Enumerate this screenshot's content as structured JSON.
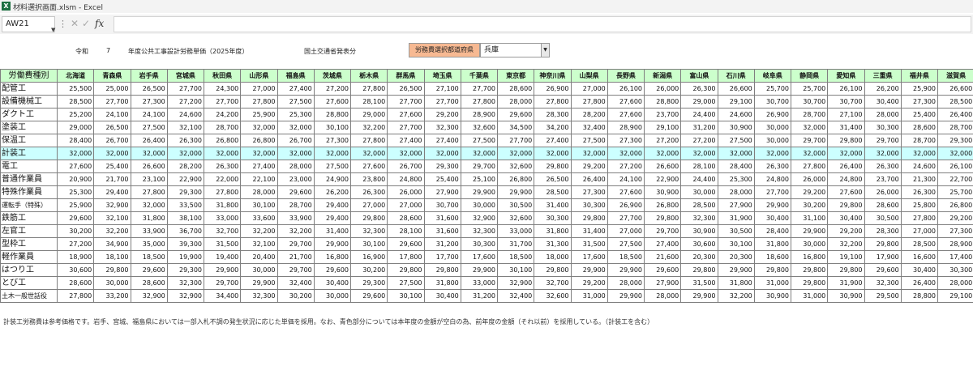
{
  "window": {
    "app_icon": "X",
    "title": "材料選択画面.xlsm - Excel"
  },
  "formula_bar": {
    "name_box": "AW21",
    "cancel_glyph": "✕",
    "enter_glyph": "✓",
    "fx_label": "fx",
    "formula": ""
  },
  "sheet_header": {
    "era": "令和",
    "era_year": "7",
    "title": "年度公共工事設計労務単価（2025年度）",
    "publisher": "国土交通省発表分",
    "pref_select_label": "労務費選択都道府県",
    "pref_select_value": "兵庫"
  },
  "table": {
    "corner": "労働費種別",
    "prefectures": [
      "北海道",
      "青森県",
      "岩手県",
      "宮城県",
      "秋田県",
      "山形県",
      "福島県",
      "茨城県",
      "栃木県",
      "群馬県",
      "埼玉県",
      "千葉県",
      "東京都",
      "神奈川県",
      "山梨県",
      "長野県",
      "新潟県",
      "富山県",
      "石川県",
      "岐阜県",
      "静岡県",
      "愛知県",
      "三重県",
      "福井県",
      "滋賀県",
      "京都府"
    ],
    "rows": [
      {
        "label": "配管工",
        "values": [
          "25,500",
          "25,000",
          "26,500",
          "27,700",
          "24,300",
          "27,000",
          "27,400",
          "27,200",
          "27,800",
          "26,500",
          "27,100",
          "27,700",
          "28,600",
          "26,900",
          "27,000",
          "26,100",
          "26,000",
          "26,300",
          "26,600",
          "25,700",
          "25,700",
          "26,100",
          "26,200",
          "25,900",
          "26,600",
          "26,500"
        ]
      },
      {
        "label": "設備機械工",
        "values": [
          "28,500",
          "27,700",
          "27,300",
          "27,200",
          "27,700",
          "27,800",
          "27,500",
          "27,600",
          "28,100",
          "27,700",
          "27,700",
          "27,800",
          "28,000",
          "27,800",
          "27,800",
          "27,600",
          "28,800",
          "29,000",
          "29,100",
          "30,700",
          "30,700",
          "30,700",
          "30,400",
          "27,300",
          "28,500",
          "28,200"
        ]
      },
      {
        "label": "ダクト工",
        "values": [
          "25,200",
          "24,100",
          "24,100",
          "24,600",
          "24,200",
          "25,900",
          "25,300",
          "28,800",
          "29,000",
          "27,600",
          "29,200",
          "28,900",
          "29,600",
          "28,300",
          "28,200",
          "27,600",
          "23,700",
          "24,400",
          "24,600",
          "26,900",
          "28,700",
          "27,100",
          "28,000",
          "25,400",
          "26,400",
          "26,800"
        ]
      },
      {
        "label": "塗装工",
        "values": [
          "29,000",
          "26,500",
          "27,500",
          "32,100",
          "28,700",
          "32,000",
          "32,000",
          "30,100",
          "32,200",
          "27,700",
          "32,300",
          "32,600",
          "34,500",
          "34,200",
          "32,400",
          "28,900",
          "29,100",
          "31,200",
          "30,900",
          "30,000",
          "32,000",
          "31,400",
          "30,300",
          "28,600",
          "28,700",
          "29,600"
        ]
      },
      {
        "label": "保温工",
        "values": [
          "28,400",
          "26,700",
          "26,400",
          "26,300",
          "26,800",
          "26,800",
          "26,700",
          "27,300",
          "27,800",
          "27,400",
          "27,400",
          "27,500",
          "27,700",
          "27,400",
          "27,500",
          "27,300",
          "27,200",
          "27,200",
          "27,500",
          "30,000",
          "29,700",
          "29,800",
          "29,700",
          "28,700",
          "29,300",
          "29,900"
        ]
      },
      {
        "label": "計装工",
        "highlight": true,
        "values": [
          "32,000",
          "32,000",
          "32,000",
          "32,000",
          "32,000",
          "32,000",
          "32,000",
          "32,000",
          "32,000",
          "32,000",
          "32,000",
          "32,000",
          "32,000",
          "32,000",
          "32,000",
          "32,000",
          "32,000",
          "32,000",
          "32,000",
          "32,000",
          "32,000",
          "32,000",
          "32,000",
          "32,000",
          "32,000",
          "32,000"
        ]
      },
      {
        "label": "電工",
        "values": [
          "27,600",
          "25,400",
          "26,600",
          "28,200",
          "26,300",
          "27,400",
          "28,000",
          "27,500",
          "27,600",
          "26,700",
          "29,300",
          "29,700",
          "32,600",
          "29,800",
          "29,200",
          "27,200",
          "26,600",
          "28,100",
          "28,400",
          "26,300",
          "27,800",
          "26,400",
          "26,300",
          "24,600",
          "26,100",
          "25,500"
        ]
      },
      {
        "label": "普通作業員",
        "values": [
          "20,900",
          "21,700",
          "23,100",
          "22,900",
          "22,000",
          "22,100",
          "23,000",
          "24,900",
          "23,800",
          "24,800",
          "25,400",
          "25,100",
          "26,800",
          "26,500",
          "26,400",
          "24,100",
          "22,900",
          "24,400",
          "25,300",
          "24,800",
          "26,000",
          "24,800",
          "23,700",
          "21,300",
          "22,700",
          "23,800"
        ]
      },
      {
        "label": "特殊作業員",
        "values": [
          "25,300",
          "29,400",
          "27,800",
          "29,300",
          "27,800",
          "28,000",
          "29,600",
          "26,200",
          "26,300",
          "26,000",
          "27,900",
          "29,900",
          "29,900",
          "28,500",
          "27,300",
          "27,600",
          "30,900",
          "30,000",
          "28,000",
          "27,700",
          "29,200",
          "27,600",
          "26,000",
          "26,300",
          "25,700",
          "28,000"
        ]
      },
      {
        "label": "運転手（特殊）",
        "small": true,
        "values": [
          "25,900",
          "32,900",
          "32,000",
          "33,500",
          "31,800",
          "30,100",
          "28,700",
          "29,400",
          "27,000",
          "27,000",
          "30,700",
          "30,000",
          "30,500",
          "31,400",
          "30,300",
          "26,900",
          "26,800",
          "28,500",
          "27,900",
          "29,900",
          "30,200",
          "29,800",
          "28,600",
          "25,800",
          "26,800",
          "25,400"
        ]
      },
      {
        "label": "鉄筋工",
        "values": [
          "29,600",
          "32,100",
          "31,800",
          "38,100",
          "33,000",
          "33,600",
          "33,900",
          "29,400",
          "29,800",
          "28,600",
          "31,600",
          "32,900",
          "32,600",
          "30,300",
          "29,800",
          "27,700",
          "29,800",
          "32,300",
          "31,900",
          "30,400",
          "31,100",
          "30,400",
          "30,500",
          "27,800",
          "29,200",
          "28,300"
        ]
      },
      {
        "label": "左官工",
        "values": [
          "30,200",
          "32,200",
          "33,900",
          "36,700",
          "32,700",
          "32,200",
          "32,200",
          "31,400",
          "32,300",
          "28,100",
          "31,600",
          "32,300",
          "33,000",
          "31,800",
          "31,400",
          "27,000",
          "29,700",
          "30,900",
          "30,500",
          "28,400",
          "29,900",
          "29,200",
          "28,300",
          "27,000",
          "27,300",
          "30,500"
        ]
      },
      {
        "label": "型枠工",
        "values": [
          "27,200",
          "34,900",
          "35,000",
          "39,300",
          "31,500",
          "32,100",
          "29,700",
          "29,900",
          "30,100",
          "29,600",
          "31,200",
          "30,300",
          "31,700",
          "31,300",
          "31,500",
          "27,500",
          "27,400",
          "30,600",
          "30,100",
          "31,800",
          "30,000",
          "32,200",
          "29,800",
          "28,500",
          "28,900",
          "29,900"
        ]
      },
      {
        "label": "軽作業員",
        "values": [
          "18,900",
          "18,100",
          "18,500",
          "19,900",
          "19,400",
          "20,400",
          "21,700",
          "16,800",
          "16,900",
          "17,800",
          "17,700",
          "17,600",
          "18,500",
          "18,000",
          "17,600",
          "18,500",
          "21,600",
          "20,300",
          "20,300",
          "18,600",
          "16,800",
          "19,100",
          "17,900",
          "16,600",
          "17,400",
          "16,400"
        ]
      },
      {
        "label": "はつり工",
        "values": [
          "30,600",
          "29,800",
          "29,600",
          "29,300",
          "29,900",
          "30,000",
          "29,700",
          "29,600",
          "30,200",
          "29,800",
          "29,800",
          "29,900",
          "30,100",
          "29,800",
          "29,900",
          "29,900",
          "29,600",
          "29,800",
          "29,900",
          "29,800",
          "29,800",
          "29,800",
          "29,600",
          "30,400",
          "30,300",
          "30,300"
        ]
      },
      {
        "label": "とび工",
        "values": [
          "28,600",
          "30,000",
          "28,600",
          "32,300",
          "29,700",
          "29,900",
          "32,400",
          "30,400",
          "29,300",
          "27,500",
          "31,800",
          "33,000",
          "32,900",
          "32,700",
          "29,200",
          "28,000",
          "27,900",
          "31,500",
          "31,800",
          "31,000",
          "29,800",
          "31,900",
          "32,300",
          "26,400",
          "28,000",
          "27,600"
        ]
      },
      {
        "label": "土木一般世話役",
        "small": true,
        "values": [
          "27,800",
          "33,200",
          "32,900",
          "32,900",
          "34,400",
          "32,300",
          "30,200",
          "30,000",
          "29,600",
          "30,100",
          "30,400",
          "31,200",
          "32,400",
          "32,600",
          "31,000",
          "29,900",
          "28,000",
          "29,900",
          "32,200",
          "30,900",
          "31,000",
          "30,900",
          "29,500",
          "28,800",
          "29,100",
          "28,900"
        ]
      }
    ]
  },
  "footnote": "計装工労務費は参考価格です。岩手、宮城、福島県においては一部入札不調の発生状況に応じた単価を採用。なお、青色部分については本年度の金額が空白の為、前年度の金額（それ以前）を採用している。（計装工を含む）"
}
